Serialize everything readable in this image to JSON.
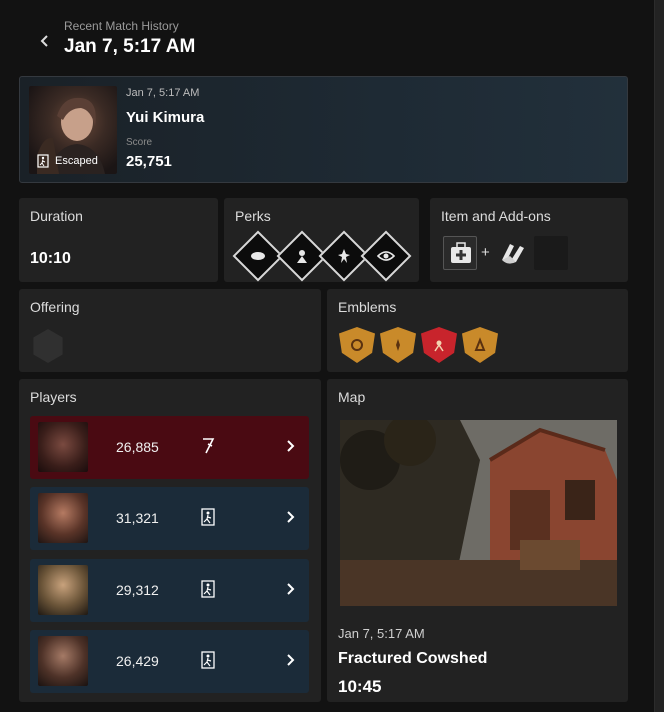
{
  "header": {
    "breadcrumb": "Recent Match History",
    "title": "Jan 7, 5:17 AM"
  },
  "summary": {
    "date": "Jan 7, 5:17 AM",
    "name": "Yui Kimura",
    "score_label": "Score",
    "score": "25,751",
    "status": "Escaped"
  },
  "duration": {
    "label": "Duration",
    "value": "10:10"
  },
  "perks": {
    "label": "Perks",
    "icons": [
      "perk-1-icon",
      "perk-2-icon",
      "perk-3-icon",
      "perk-4-icon"
    ]
  },
  "items": {
    "label": "Item and Add-ons",
    "plus": "+",
    "icons": [
      "medkit-icon",
      "gloves-addon-icon",
      "empty-addon-slot"
    ]
  },
  "offering": {
    "label": "Offering"
  },
  "emblems": {
    "label": "Emblems",
    "colors": [
      "#c98a2a",
      "#c98a2a",
      "#c8242c",
      "#c98a2a"
    ]
  },
  "players": {
    "label": "Players",
    "rows": [
      {
        "score": "26,885",
        "status": "killer-icon",
        "bg": "#4a0a12"
      },
      {
        "score": "31,321",
        "status": "escaped-icon",
        "bg": "#1b2b39"
      },
      {
        "score": "29,312",
        "status": "escaped-icon",
        "bg": "#1b2b39"
      },
      {
        "score": "26,429",
        "status": "escaped-icon",
        "bg": "#1b2b39"
      }
    ]
  },
  "map": {
    "label": "Map",
    "date": "Jan 7, 5:17 AM",
    "name": "Fractured Cowshed",
    "time": "10:45"
  }
}
